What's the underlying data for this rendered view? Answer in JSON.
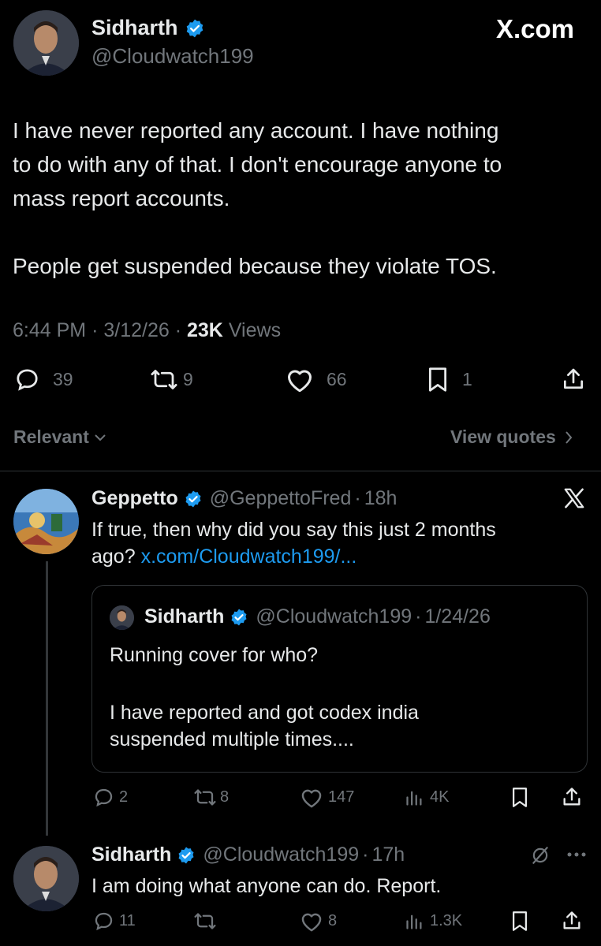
{
  "main_post": {
    "author_name": "Sidharth",
    "author_handle": "@Cloudwatch199",
    "brand": "X.com",
    "text_line1": "I have never reported any account. I have nothing",
    "text_line2": "to do with any of that. I don't encourage anyone to",
    "text_line3": "mass report accounts.",
    "text_line4": "People get suspended because they violate TOS.",
    "time": "6:44 PM",
    "date": "3/12/26",
    "views_count": "23K",
    "views_label": "Views",
    "replies": "39",
    "reposts": "9",
    "likes": "66",
    "bookmarks": "1"
  },
  "sort_bar": {
    "relevant_label": "Relevant",
    "view_quotes_label": "View quotes"
  },
  "reply1": {
    "author_name": "Geppetto",
    "author_handle": "@GeppettoFred",
    "time": "18h",
    "text_line1": "If true, then why did you say this just 2 months",
    "text_line2_prefix": "ago?",
    "link_text": "x.com/Cloudwatch199/...",
    "quote": {
      "author_name": "Sidharth",
      "author_handle": "@Cloudwatch199",
      "date": "1/24/26",
      "text_line1": "Running cover for who?",
      "text_line2": "I have reported and got codex india",
      "text_line3": "suspended multiple times...."
    },
    "replies": "2",
    "reposts": "8",
    "likes": "147",
    "views": "4K"
  },
  "reply2": {
    "author_name": "Sidharth",
    "author_handle": "@Cloudwatch199",
    "time": "17h",
    "text": "I am doing what anyone can do. Report.",
    "replies": "11",
    "likes": "8",
    "views": "1.3K"
  },
  "colors": {
    "background": "#000000",
    "text": "#e7e9ea",
    "muted": "#71767b",
    "accent": "#1d9bf0",
    "divider": "#2f3336"
  }
}
